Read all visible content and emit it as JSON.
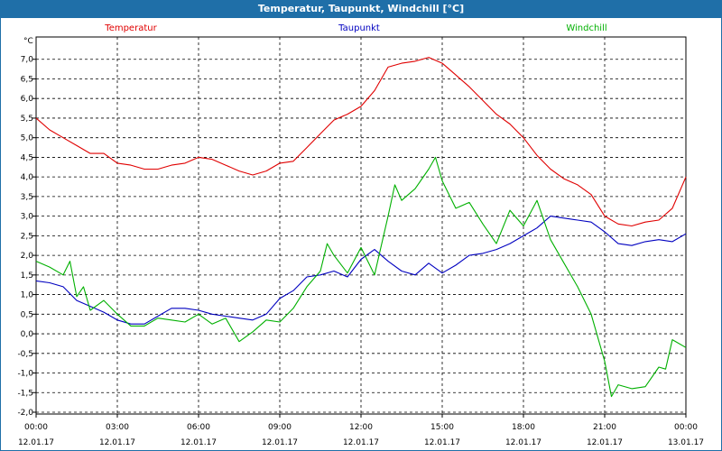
{
  "window": {
    "title": "Temperatur, Taupunkt, Windchill [°C]"
  },
  "chart_data": {
    "type": "line",
    "title": "Temperatur, Taupunkt, Windchill [°C]",
    "ylabel": "°C",
    "ylim": [
      -2.0,
      7.5
    ],
    "xlim_hours": [
      0,
      24
    ],
    "grid": true,
    "legend_position": "top",
    "y_ticks": [
      "7,0",
      "6,5",
      "6,0",
      "5,5",
      "5,0",
      "4,5",
      "4,0",
      "3,5",
      "3,0",
      "2,5",
      "2,0",
      "1,5",
      "1,0",
      "0,5",
      "0,0",
      "-0,5",
      "-1,0",
      "-1,5",
      "-2,0"
    ],
    "x_ticks": [
      {
        "time": "00:00",
        "date": "12.01.17"
      },
      {
        "time": "03:00",
        "date": "12.01.17"
      },
      {
        "time": "06:00",
        "date": "12.01.17"
      },
      {
        "time": "09:00",
        "date": "12.01.17"
      },
      {
        "time": "12:00",
        "date": "12.01.17"
      },
      {
        "time": "15:00",
        "date": "12.01.17"
      },
      {
        "time": "18:00",
        "date": "12.01.17"
      },
      {
        "time": "21:00",
        "date": "12.01.17"
      },
      {
        "time": "00:00",
        "date": "13.01.17"
      }
    ],
    "series": [
      {
        "name": "Temperatur",
        "color": "#e00000",
        "points": [
          [
            0,
            5.5
          ],
          [
            0.5,
            5.2
          ],
          [
            1,
            5.0
          ],
          [
            1.5,
            4.8
          ],
          [
            2,
            4.6
          ],
          [
            2.5,
            4.6
          ],
          [
            3,
            4.35
          ],
          [
            3.5,
            4.3
          ],
          [
            4,
            4.2
          ],
          [
            4.5,
            4.2
          ],
          [
            5,
            4.3
          ],
          [
            5.5,
            4.35
          ],
          [
            6,
            4.5
          ],
          [
            6.5,
            4.45
          ],
          [
            7,
            4.3
          ],
          [
            7.5,
            4.15
          ],
          [
            8,
            4.05
          ],
          [
            8.5,
            4.15
          ],
          [
            9,
            4.35
          ],
          [
            9.5,
            4.4
          ],
          [
            10,
            4.75
          ],
          [
            10.5,
            5.1
          ],
          [
            11,
            5.45
          ],
          [
            11.5,
            5.6
          ],
          [
            12,
            5.8
          ],
          [
            12.5,
            6.2
          ],
          [
            13,
            6.8
          ],
          [
            13.5,
            6.9
          ],
          [
            14,
            6.95
          ],
          [
            14.5,
            7.05
          ],
          [
            15,
            6.9
          ],
          [
            15.5,
            6.6
          ],
          [
            16,
            6.3
          ],
          [
            16.5,
            5.95
          ],
          [
            17,
            5.6
          ],
          [
            17.5,
            5.35
          ],
          [
            18,
            5.0
          ],
          [
            18.5,
            4.55
          ],
          [
            19,
            4.2
          ],
          [
            19.5,
            3.95
          ],
          [
            20,
            3.8
          ],
          [
            20.5,
            3.55
          ],
          [
            21,
            3.0
          ],
          [
            21.5,
            2.8
          ],
          [
            22,
            2.75
          ],
          [
            22.5,
            2.85
          ],
          [
            23,
            2.9
          ],
          [
            23.5,
            3.2
          ],
          [
            24,
            4.0
          ]
        ]
      },
      {
        "name": "Taupunkt",
        "color": "#0000c0",
        "points": [
          [
            0,
            1.35
          ],
          [
            0.5,
            1.3
          ],
          [
            1,
            1.2
          ],
          [
            1.5,
            0.85
          ],
          [
            2,
            0.7
          ],
          [
            2.5,
            0.55
          ],
          [
            3,
            0.35
          ],
          [
            3.5,
            0.25
          ],
          [
            4,
            0.25
          ],
          [
            4.5,
            0.45
          ],
          [
            5,
            0.65
          ],
          [
            5.5,
            0.65
          ],
          [
            6,
            0.6
          ],
          [
            6.5,
            0.5
          ],
          [
            7,
            0.45
          ],
          [
            7.5,
            0.4
          ],
          [
            8,
            0.35
          ],
          [
            8.5,
            0.5
          ],
          [
            9,
            0.9
          ],
          [
            9.5,
            1.1
          ],
          [
            10,
            1.45
          ],
          [
            10.5,
            1.5
          ],
          [
            11,
            1.6
          ],
          [
            11.5,
            1.45
          ],
          [
            12,
            1.9
          ],
          [
            12.5,
            2.15
          ],
          [
            13,
            1.85
          ],
          [
            13.5,
            1.6
          ],
          [
            14,
            1.5
          ],
          [
            14.5,
            1.8
          ],
          [
            15,
            1.55
          ],
          [
            15.5,
            1.75
          ],
          [
            16,
            2.0
          ],
          [
            16.5,
            2.05
          ],
          [
            17,
            2.15
          ],
          [
            17.5,
            2.3
          ],
          [
            18,
            2.5
          ],
          [
            18.5,
            2.7
          ],
          [
            19,
            3.0
          ],
          [
            19.5,
            2.95
          ],
          [
            20,
            2.9
          ],
          [
            20.5,
            2.85
          ],
          [
            21,
            2.6
          ],
          [
            21.5,
            2.3
          ],
          [
            22,
            2.25
          ],
          [
            22.5,
            2.35
          ],
          [
            23,
            2.4
          ],
          [
            23.5,
            2.35
          ],
          [
            24,
            2.55
          ]
        ]
      },
      {
        "name": "Windchill",
        "color": "#00b000",
        "points": [
          [
            0,
            1.85
          ],
          [
            0.5,
            1.7
          ],
          [
            1,
            1.5
          ],
          [
            1.25,
            1.85
          ],
          [
            1.5,
            0.95
          ],
          [
            1.75,
            1.2
          ],
          [
            2,
            0.6
          ],
          [
            2.5,
            0.85
          ],
          [
            3,
            0.5
          ],
          [
            3.5,
            0.2
          ],
          [
            4,
            0.2
          ],
          [
            4.5,
            0.4
          ],
          [
            5,
            0.35
          ],
          [
            5.5,
            0.3
          ],
          [
            6,
            0.5
          ],
          [
            6.5,
            0.25
          ],
          [
            7,
            0.4
          ],
          [
            7.5,
            -0.2
          ],
          [
            8,
            0.05
          ],
          [
            8.5,
            0.35
          ],
          [
            9,
            0.3
          ],
          [
            9.5,
            0.65
          ],
          [
            10,
            1.2
          ],
          [
            10.5,
            1.6
          ],
          [
            10.75,
            2.3
          ],
          [
            11,
            2.0
          ],
          [
            11.5,
            1.55
          ],
          [
            12,
            2.2
          ],
          [
            12.5,
            1.5
          ],
          [
            13,
            3.0
          ],
          [
            13.25,
            3.8
          ],
          [
            13.5,
            3.4
          ],
          [
            14,
            3.7
          ],
          [
            14.5,
            4.2
          ],
          [
            14.75,
            4.5
          ],
          [
            15,
            3.9
          ],
          [
            15.5,
            3.2
          ],
          [
            16,
            3.35
          ],
          [
            16.5,
            2.8
          ],
          [
            17,
            2.3
          ],
          [
            17.5,
            3.15
          ],
          [
            18,
            2.75
          ],
          [
            18.5,
            3.4
          ],
          [
            19,
            2.4
          ],
          [
            19.5,
            1.8
          ],
          [
            20,
            1.2
          ],
          [
            20.5,
            0.5
          ],
          [
            21,
            -0.7
          ],
          [
            21.25,
            -1.6
          ],
          [
            21.5,
            -1.3
          ],
          [
            22,
            -1.4
          ],
          [
            22.5,
            -1.35
          ],
          [
            23,
            -0.85
          ],
          [
            23.25,
            -0.9
          ],
          [
            23.5,
            -0.15
          ],
          [
            24,
            -0.35
          ]
        ]
      }
    ]
  }
}
